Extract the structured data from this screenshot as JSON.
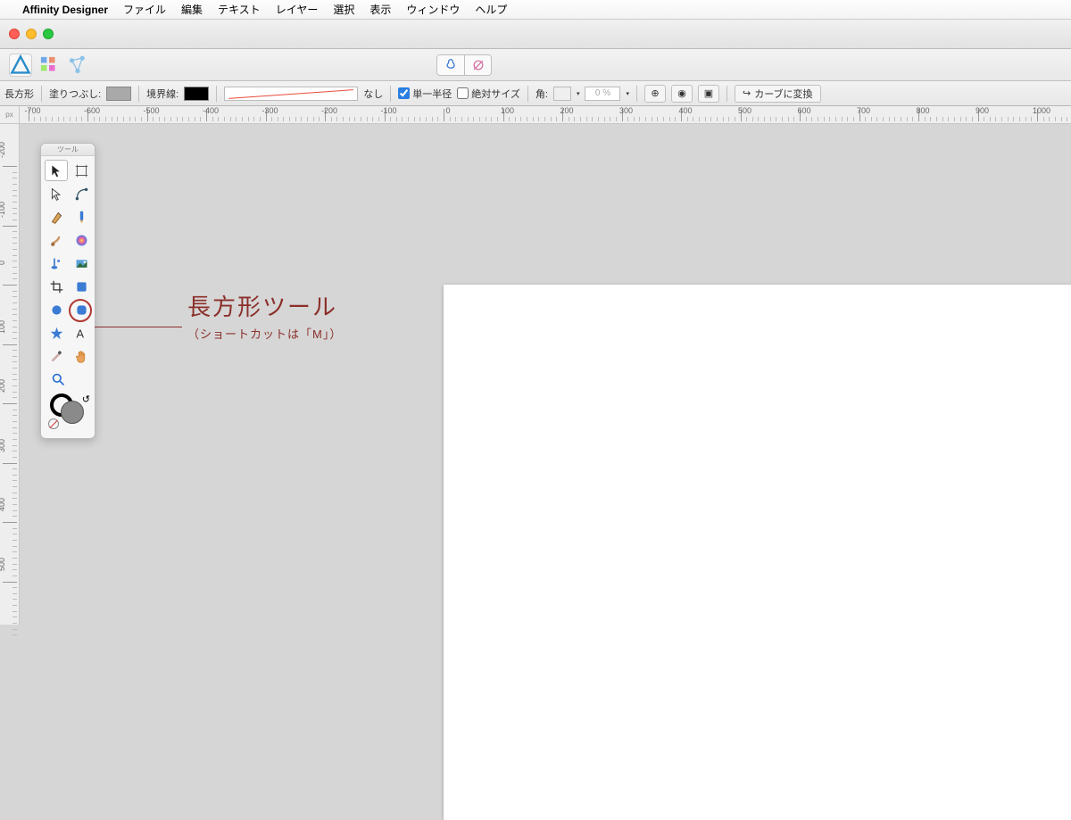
{
  "menubar": {
    "app": "Affinity Designer",
    "items": [
      "ファイル",
      "編集",
      "テキスト",
      "レイヤー",
      "選択",
      "表示",
      "ウィンドウ",
      "ヘルプ"
    ]
  },
  "ctx": {
    "shape": "長方形",
    "fill_label": "塗りつぶし:",
    "stroke_label": "境界線:",
    "stroke_style": "なし",
    "single_radius": "単一半径",
    "abs_size": "絶対サイズ",
    "corner_label": "角:",
    "corner_pct": "0 %",
    "convert": "カーブに変換"
  },
  "ruler": {
    "unit": "px",
    "hticks": [
      -700,
      -600,
      -500,
      -400,
      -300,
      -200,
      -100,
      0,
      100,
      200,
      300,
      400,
      500,
      600,
      700,
      800,
      900,
      1000
    ],
    "vticks": [
      -200,
      -100,
      0,
      100,
      200,
      300,
      400,
      500
    ]
  },
  "tools": {
    "panel_title": "ツール"
  },
  "callout": {
    "title": "長方形ツール",
    "sub": "（ショートカットは「M」）"
  }
}
